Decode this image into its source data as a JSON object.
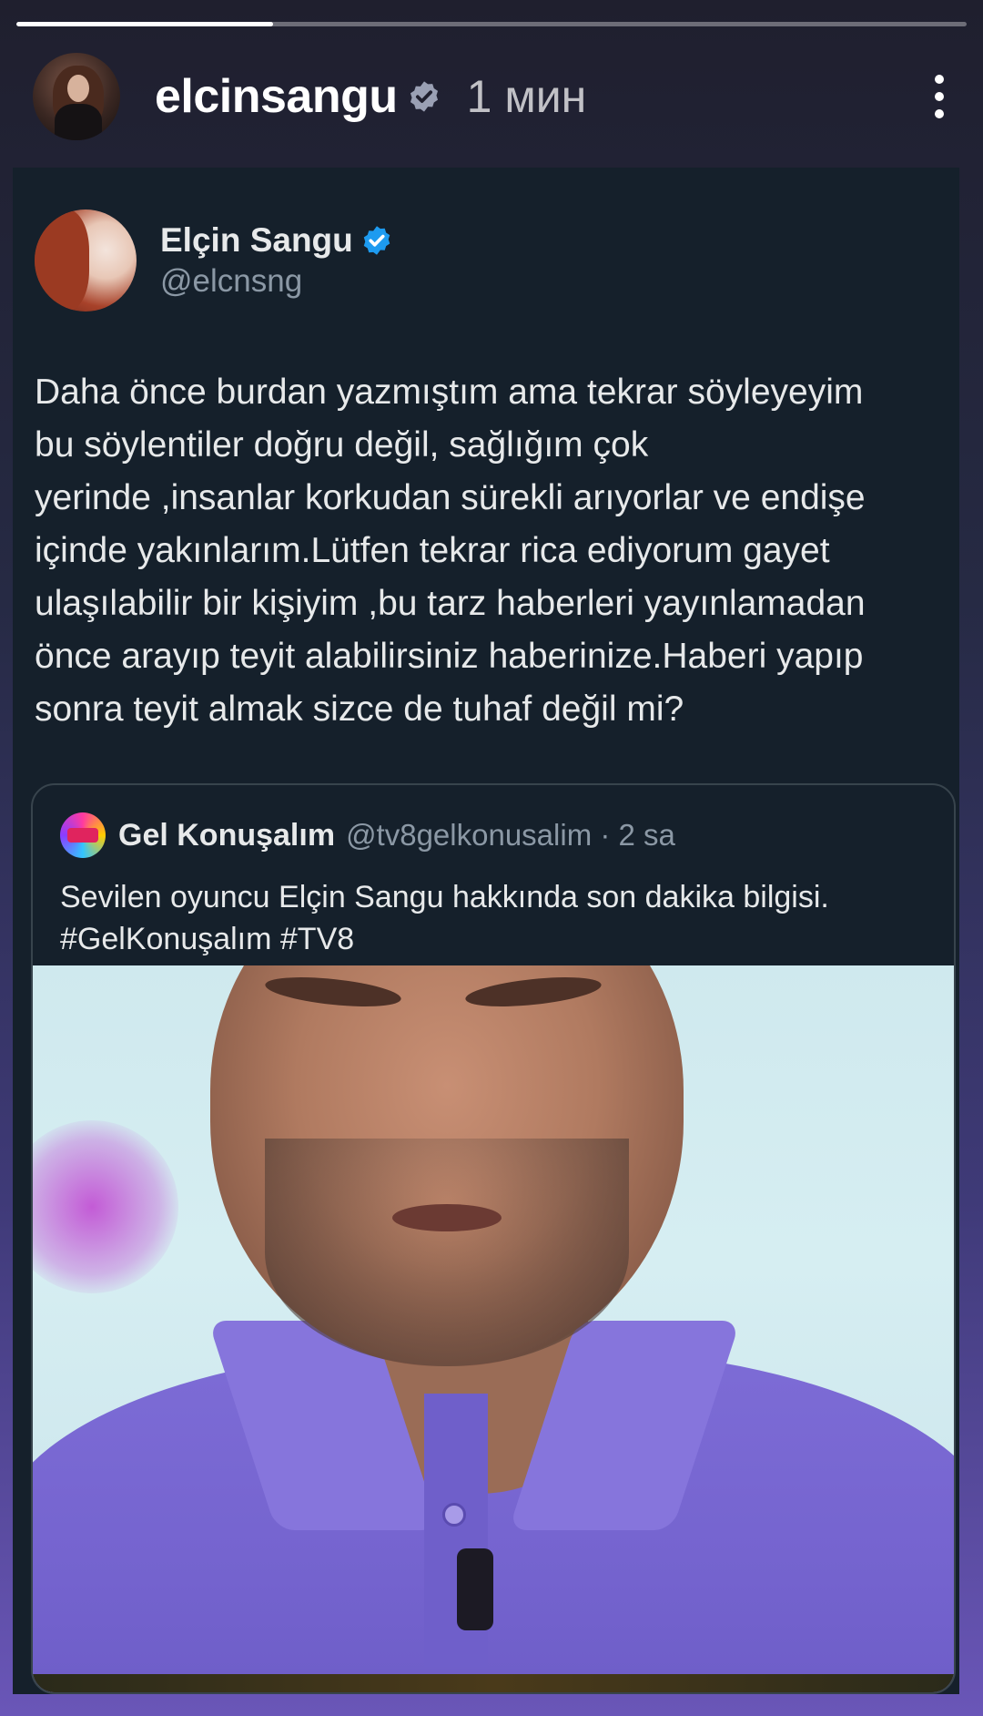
{
  "story": {
    "progress": 0.27,
    "username": "elcinsangu",
    "time": "1 мин"
  },
  "tweet": {
    "display_name": "Elçin Sangu",
    "handle": "@elcnsng",
    "text": "Daha önce burdan yazmıştım ama tekrar söyleyeyim\nbu söylentiler doğru değil, sağlığım çok\nyerinde ,insanlar korkudan sürekli arıyorlar ve endişe\niçinde yakınlarım.Lütfen tekrar rica ediyorum gayet\nulaşılabilir bir kişiyim ,bu tarz haberleri yayınlamadan\nönce arayıp teyit alabilirsiniz haberinize.Haberi yapıp\nsonra teyit almak sizce de tuhaf değil mi?"
  },
  "quote": {
    "display_name": "Gel Konuşalım",
    "handle_time": "@tv8gelkonusalim · 2 sa",
    "text": "Sevilen oyuncu Elçin Sangu hakkında son dakika bilgisi.\n#GelKonuşalım #TV8"
  },
  "colors": {
    "verified_blue": "#1d9bf0",
    "card_bg": "#15202b",
    "shirt_purple": "#7564cf"
  }
}
